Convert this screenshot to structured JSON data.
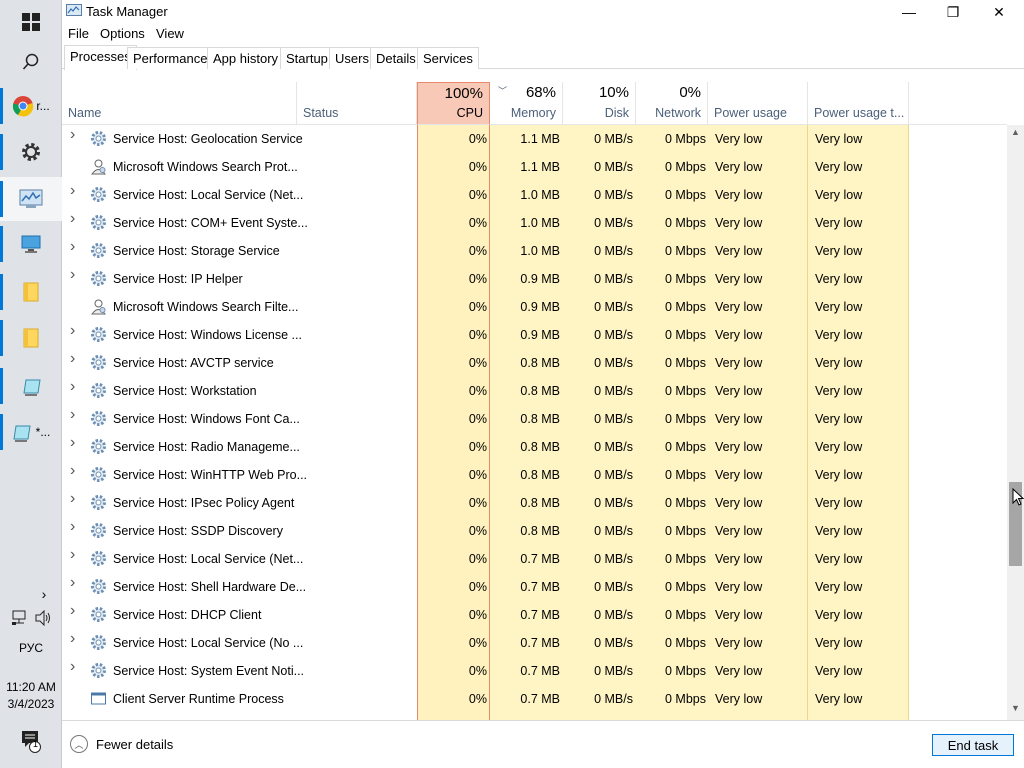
{
  "window": {
    "title": "Task Manager",
    "controls": {
      "minimize": "—",
      "maximize": "❐",
      "close": "✕"
    }
  },
  "menu": [
    "File",
    "Options",
    "View"
  ],
  "tabs": [
    "Processes",
    "Performance",
    "App history",
    "Startup",
    "Users",
    "Details",
    "Services"
  ],
  "selected_tab": "Processes",
  "columns": {
    "name": "Name",
    "status": "Status",
    "cpu": {
      "pct": "100%",
      "label": "CPU"
    },
    "memory": {
      "pct": "68%",
      "label": "Memory"
    },
    "disk": {
      "pct": "10%",
      "label": "Disk"
    },
    "network": {
      "pct": "0%",
      "label": "Network"
    },
    "power": "Power usage",
    "power_trend": "Power usage t..."
  },
  "processes": [
    {
      "name": "Service Host: Geolocation Service",
      "expandable": true,
      "icon": "gear",
      "cpu": "0%",
      "memory": "1.1 MB",
      "disk": "0 MB/s",
      "network": "0 Mbps",
      "power": "Very low",
      "power_trend": "Very low"
    },
    {
      "name": "Microsoft Windows Search Prot...",
      "expandable": false,
      "icon": "user",
      "cpu": "0%",
      "memory": "1.1 MB",
      "disk": "0 MB/s",
      "network": "0 Mbps",
      "power": "Very low",
      "power_trend": "Very low"
    },
    {
      "name": "Service Host: Local Service (Net...",
      "expandable": true,
      "icon": "gear",
      "cpu": "0%",
      "memory": "1.0 MB",
      "disk": "0 MB/s",
      "network": "0 Mbps",
      "power": "Very low",
      "power_trend": "Very low"
    },
    {
      "name": "Service Host: COM+ Event Syste...",
      "expandable": true,
      "icon": "gear",
      "cpu": "0%",
      "memory": "1.0 MB",
      "disk": "0 MB/s",
      "network": "0 Mbps",
      "power": "Very low",
      "power_trend": "Very low"
    },
    {
      "name": "Service Host: Storage Service",
      "expandable": true,
      "icon": "gear",
      "cpu": "0%",
      "memory": "1.0 MB",
      "disk": "0 MB/s",
      "network": "0 Mbps",
      "power": "Very low",
      "power_trend": "Very low"
    },
    {
      "name": "Service Host: IP Helper",
      "expandable": true,
      "icon": "gear",
      "cpu": "0%",
      "memory": "0.9 MB",
      "disk": "0 MB/s",
      "network": "0 Mbps",
      "power": "Very low",
      "power_trend": "Very low"
    },
    {
      "name": "Microsoft Windows Search Filte...",
      "expandable": false,
      "icon": "user",
      "cpu": "0%",
      "memory": "0.9 MB",
      "disk": "0 MB/s",
      "network": "0 Mbps",
      "power": "Very low",
      "power_trend": "Very low"
    },
    {
      "name": "Service Host: Windows License ...",
      "expandable": true,
      "icon": "gear",
      "cpu": "0%",
      "memory": "0.9 MB",
      "disk": "0 MB/s",
      "network": "0 Mbps",
      "power": "Very low",
      "power_trend": "Very low"
    },
    {
      "name": "Service Host: AVCTP service",
      "expandable": true,
      "icon": "gear",
      "cpu": "0%",
      "memory": "0.8 MB",
      "disk": "0 MB/s",
      "network": "0 Mbps",
      "power": "Very low",
      "power_trend": "Very low"
    },
    {
      "name": "Service Host: Workstation",
      "expandable": true,
      "icon": "gear",
      "cpu": "0%",
      "memory": "0.8 MB",
      "disk": "0 MB/s",
      "network": "0 Mbps",
      "power": "Very low",
      "power_trend": "Very low"
    },
    {
      "name": "Service Host: Windows Font Ca...",
      "expandable": true,
      "icon": "gear",
      "cpu": "0%",
      "memory": "0.8 MB",
      "disk": "0 MB/s",
      "network": "0 Mbps",
      "power": "Very low",
      "power_trend": "Very low"
    },
    {
      "name": "Service Host: Radio Manageme...",
      "expandable": true,
      "icon": "gear",
      "cpu": "0%",
      "memory": "0.8 MB",
      "disk": "0 MB/s",
      "network": "0 Mbps",
      "power": "Very low",
      "power_trend": "Very low"
    },
    {
      "name": "Service Host: WinHTTP Web Pro...",
      "expandable": true,
      "icon": "gear",
      "cpu": "0%",
      "memory": "0.8 MB",
      "disk": "0 MB/s",
      "network": "0 Mbps",
      "power": "Very low",
      "power_trend": "Very low"
    },
    {
      "name": "Service Host: IPsec Policy Agent",
      "expandable": true,
      "icon": "gear",
      "cpu": "0%",
      "memory": "0.8 MB",
      "disk": "0 MB/s",
      "network": "0 Mbps",
      "power": "Very low",
      "power_trend": "Very low"
    },
    {
      "name": "Service Host: SSDP Discovery",
      "expandable": true,
      "icon": "gear",
      "cpu": "0%",
      "memory": "0.8 MB",
      "disk": "0 MB/s",
      "network": "0 Mbps",
      "power": "Very low",
      "power_trend": "Very low"
    },
    {
      "name": "Service Host: Local Service (Net...",
      "expandable": true,
      "icon": "gear",
      "cpu": "0%",
      "memory": "0.7 MB",
      "disk": "0 MB/s",
      "network": "0 Mbps",
      "power": "Very low",
      "power_trend": "Very low"
    },
    {
      "name": "Service Host: Shell Hardware De...",
      "expandable": true,
      "icon": "gear",
      "cpu": "0%",
      "memory": "0.7 MB",
      "disk": "0 MB/s",
      "network": "0 Mbps",
      "power": "Very low",
      "power_trend": "Very low"
    },
    {
      "name": "Service Host: DHCP Client",
      "expandable": true,
      "icon": "gear",
      "cpu": "0%",
      "memory": "0.7 MB",
      "disk": "0 MB/s",
      "network": "0 Mbps",
      "power": "Very low",
      "power_trend": "Very low"
    },
    {
      "name": "Service Host: Local Service (No ...",
      "expandable": true,
      "icon": "gear",
      "cpu": "0%",
      "memory": "0.7 MB",
      "disk": "0 MB/s",
      "network": "0 Mbps",
      "power": "Very low",
      "power_trend": "Very low"
    },
    {
      "name": "Service Host: System Event Noti...",
      "expandable": true,
      "icon": "gear",
      "cpu": "0%",
      "memory": "0.7 MB",
      "disk": "0 MB/s",
      "network": "0 Mbps",
      "power": "Very low",
      "power_trend": "Very low"
    },
    {
      "name": "Client Server Runtime Process",
      "expandable": false,
      "icon": "window",
      "cpu": "0%",
      "memory": "0.7 MB",
      "disk": "0 MB/s",
      "network": "0 Mbps",
      "power": "Very low",
      "power_trend": "Very low"
    }
  ],
  "footer": {
    "fewer_details": "Fewer details",
    "end_task": "End task"
  },
  "taskbar": {
    "chrome_label": "r...",
    "window_label": "*...",
    "language": "РУС",
    "time": "11:20 AM",
    "date": "3/4/2023",
    "notification_count": "1"
  },
  "colors": {
    "accent": "#0078d7",
    "cpu_header": "#f8c9b6",
    "cell_highlight": "#fff4c4"
  }
}
